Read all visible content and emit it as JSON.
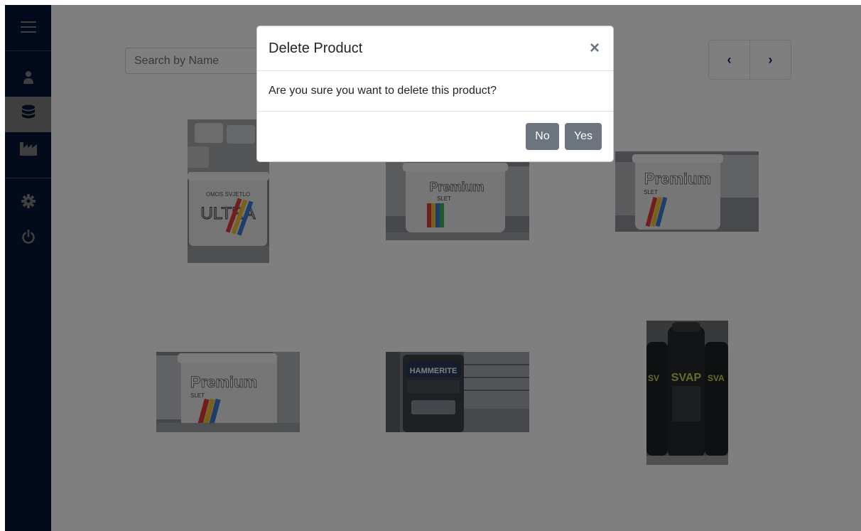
{
  "sidebar": {
    "background": "#0b2a6f",
    "items": [
      {
        "icon": "menu-icon"
      },
      {
        "icon": "user-icon"
      },
      {
        "icon": "database-icon",
        "active": true
      },
      {
        "icon": "industry-icon"
      },
      {
        "icon": "gear-icon"
      },
      {
        "icon": "power-icon"
      }
    ]
  },
  "search": {
    "placeholder": "Search by Name",
    "value": ""
  },
  "pagination": {
    "prev_label": "‹",
    "next_label": "›"
  },
  "products": [
    {
      "name": "ULTRA paint bucket",
      "lettering": "ULTRA"
    },
    {
      "name": "Premium SLET paint bucket",
      "lettering": "Premium"
    },
    {
      "name": "Premium SLET paint bucket",
      "lettering": "Premium"
    },
    {
      "name": "Premium SLET paint bucket",
      "lettering": "Premium"
    },
    {
      "name": "HAMMERITE paint can",
      "lettering": "HAMMERITE"
    },
    {
      "name": "SVAP spray cans",
      "lettering": "SVAP"
    }
  ],
  "modal": {
    "title": "Delete Product",
    "close_label": "×",
    "message": "Are you sure you want to delete this product?",
    "no_label": "No",
    "yes_label": "Yes"
  },
  "colors": {
    "brand": "#0b2a6f",
    "button": "#6c757d",
    "overlay": "rgba(0,0,0,0.5)"
  }
}
